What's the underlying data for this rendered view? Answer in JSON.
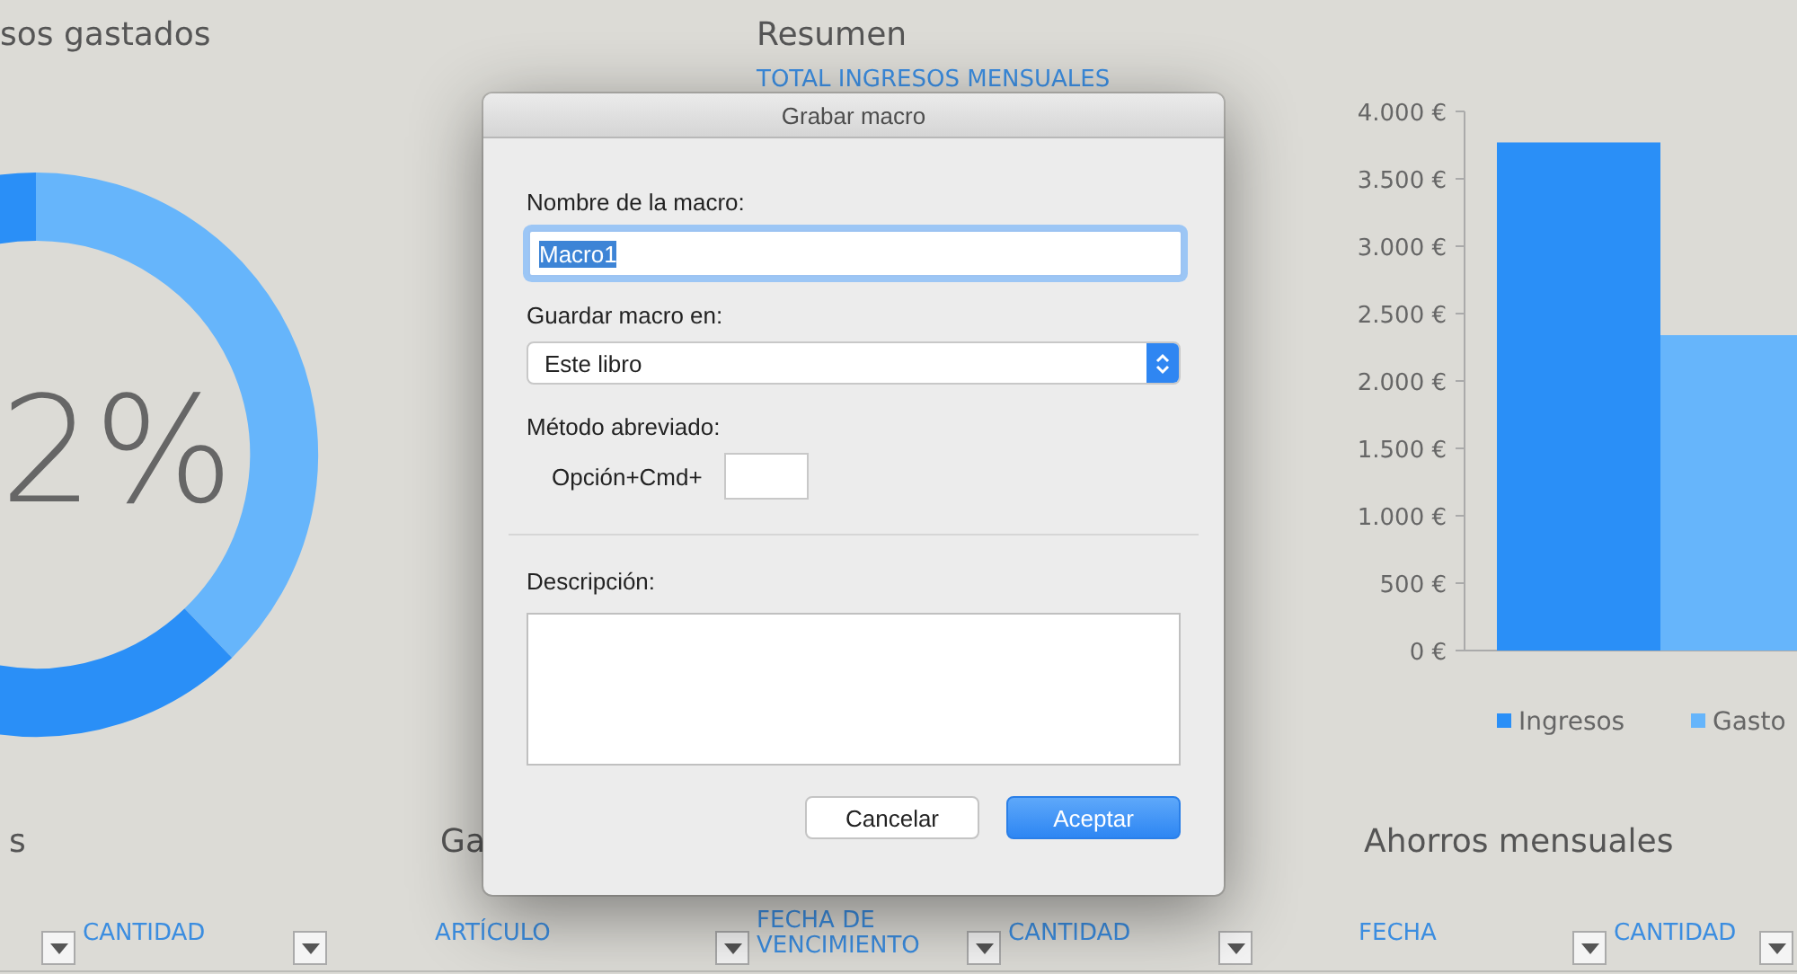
{
  "donut_panel": {
    "title": "sos gastados",
    "percent": "2%"
  },
  "resumen": {
    "title": "Resumen",
    "header": "TOTAL INGRESOS MENSUALES"
  },
  "chart": {
    "chart_data": {
      "type": "bar",
      "legend": "bottom",
      "ylim": [
        0,
        4000
      ],
      "yticks": [
        {
          "value": 0,
          "label": "0 €"
        },
        {
          "value": 500,
          "label": "500 €"
        },
        {
          "value": 1000,
          "label": "1.000 €"
        },
        {
          "value": 1500,
          "label": "1.500 €"
        },
        {
          "value": 2000,
          "label": "2.000 €"
        },
        {
          "value": 2500,
          "label": "2.500 €"
        },
        {
          "value": 3000,
          "label": "3.000 €"
        },
        {
          "value": 3500,
          "label": "3.500 €"
        },
        {
          "value": 4000,
          "label": "4.000 €"
        }
      ],
      "series": [
        {
          "name": "Ingresos",
          "color": "#2a8ff7",
          "values": [
            3770
          ]
        },
        {
          "name": "Gasto",
          "color": "#66b5fb",
          "values": [
            2340
          ]
        }
      ]
    }
  },
  "tables": [
    {
      "title": "s",
      "columns": [
        {
          "kind": "filter-only"
        },
        {
          "kind": "header",
          "label": "CANTIDAD"
        }
      ]
    },
    {
      "title": "Ga",
      "columns": [
        {
          "kind": "header",
          "label": "ARTÍCULO"
        },
        {
          "kind": "header",
          "label": "FECHA DE VENCIMIENTO"
        },
        {
          "kind": "header",
          "label": "CANTIDAD"
        }
      ]
    },
    {
      "title": "Ahorros mensuales",
      "columns": [
        {
          "kind": "header",
          "label": "FECHA"
        },
        {
          "kind": "header",
          "label": "CANTIDAD"
        }
      ]
    }
  ],
  "dialog": {
    "title": "Grabar macro",
    "name_label": "Nombre de la macro:",
    "name_value": "Macro1",
    "name_selected": true,
    "store_label": "Guardar macro en:",
    "store_value": "Este libro",
    "shortcut_label": "Método abreviado:",
    "shortcut_prefix": "Opción+Cmd+",
    "description_label": "Descripción:",
    "buttons": [
      {
        "label": "Cancelar",
        "kind": "secondary"
      },
      {
        "label": "Aceptar",
        "kind": "default"
      }
    ]
  }
}
